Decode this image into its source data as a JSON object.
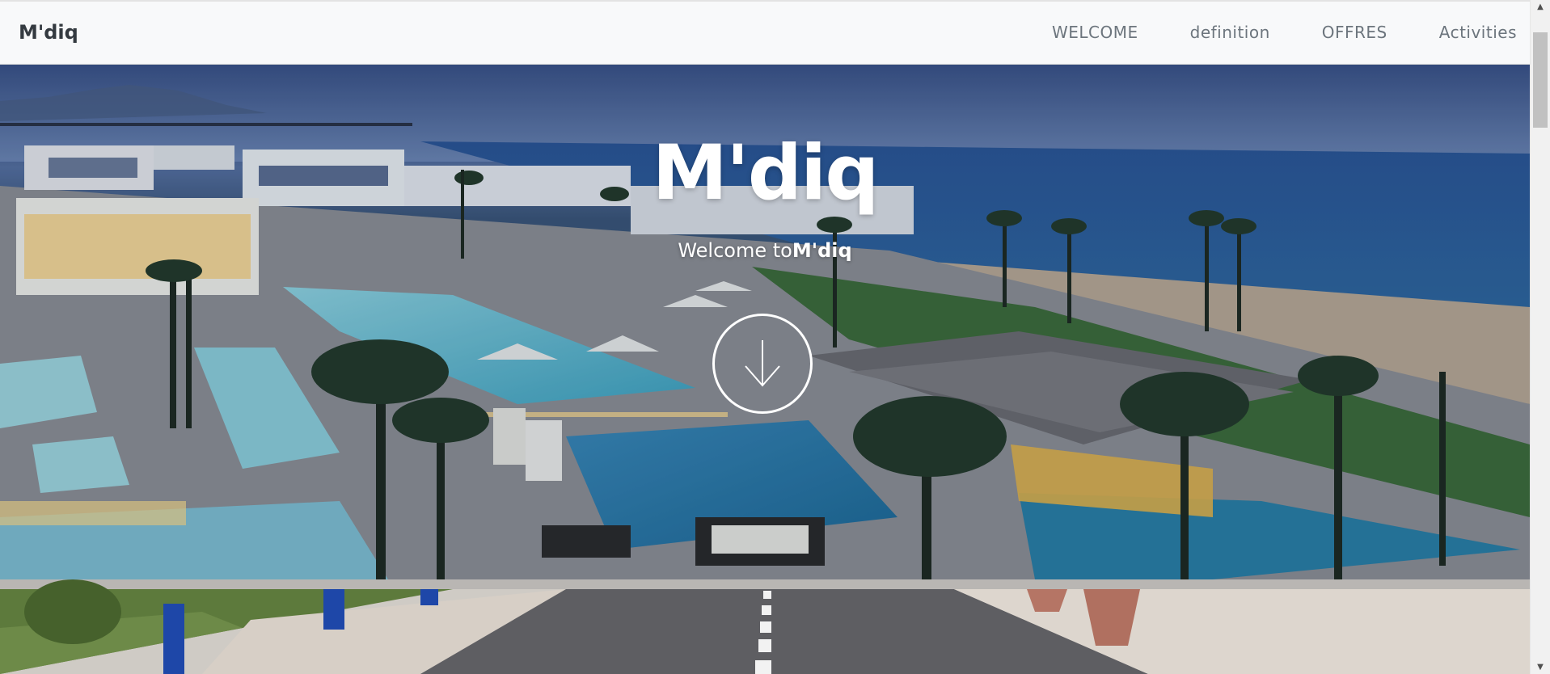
{
  "navbar": {
    "brand": "M'diq",
    "links": [
      "WELCOME",
      "definition",
      "OFFRES",
      "Activities"
    ]
  },
  "hero": {
    "title": "M'diq",
    "subtitle_prefix": "Welcome to",
    "subtitle_emphasis": "M'diq",
    "scroll_icon": "arrow-down-circle-icon"
  },
  "scrollbar": {
    "up_icon": "triangle-up-icon",
    "down_icon": "triangle-down-icon"
  },
  "colors": {
    "navbar_bg": "#f8f9fa",
    "brand": "#343a40",
    "nav_link": "#6c757d",
    "hero_text": "#ffffff"
  }
}
